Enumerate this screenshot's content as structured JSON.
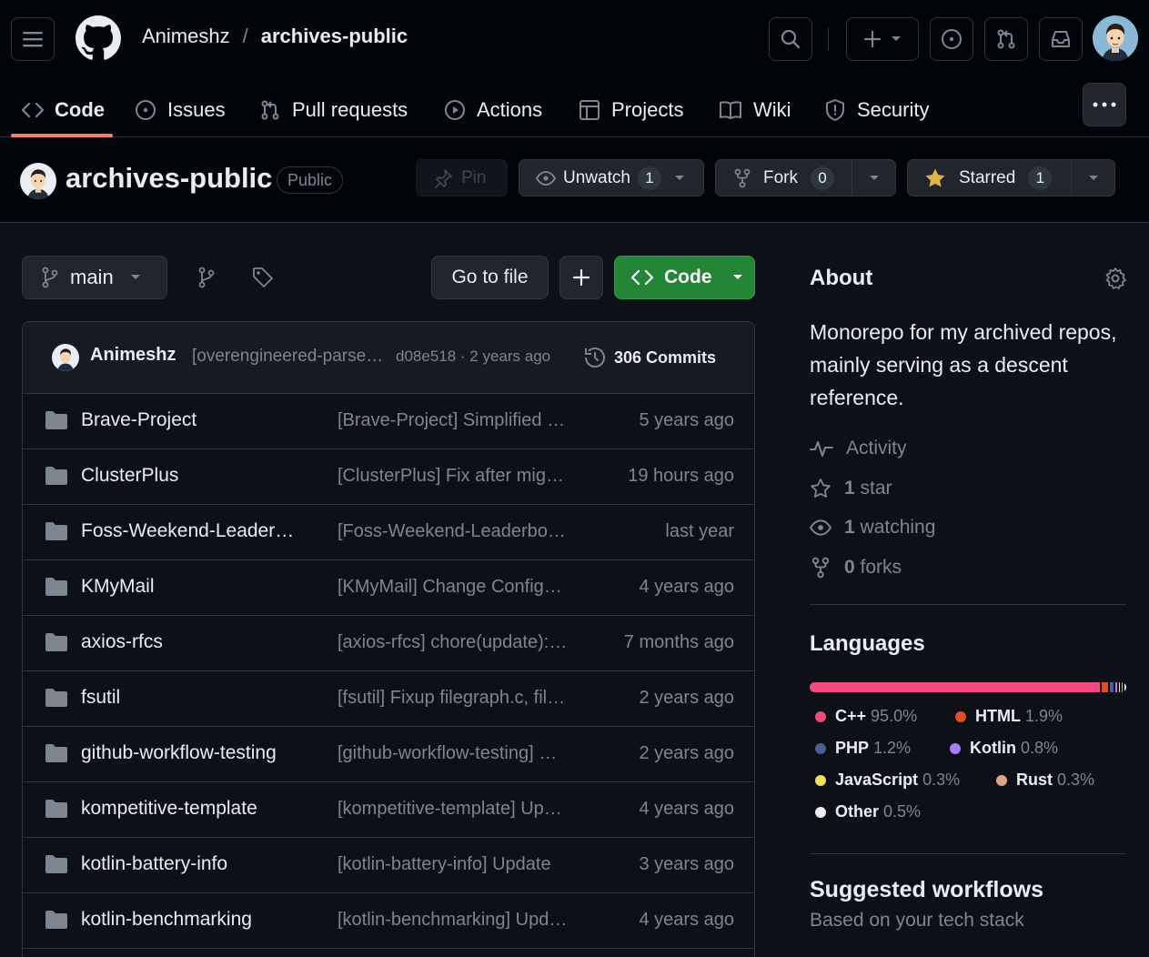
{
  "breadcrumb": {
    "owner": "Animeshz",
    "separator": "/",
    "repo": "archives-public"
  },
  "tabs": [
    {
      "label": "Code",
      "icon": "code-icon"
    },
    {
      "label": "Issues",
      "icon": "issue-icon"
    },
    {
      "label": "Pull requests",
      "icon": "pull-request-icon"
    },
    {
      "label": "Actions",
      "icon": "play-icon"
    },
    {
      "label": "Projects",
      "icon": "table-icon"
    },
    {
      "label": "Wiki",
      "icon": "book-icon"
    },
    {
      "label": "Security",
      "icon": "shield-icon"
    }
  ],
  "repo_header": {
    "name": "archives-public",
    "visibility": "Public",
    "pin_label": "Pin",
    "watch_label": "Unwatch",
    "watch_count": "1",
    "fork_label": "Fork",
    "fork_count": "0",
    "star_label": "Starred",
    "star_count": "1"
  },
  "toolbar": {
    "branch": "main",
    "goto_file": "Go to file",
    "code_button": "Code"
  },
  "latest_commit": {
    "author": "Animeshz",
    "message": "[overengineered-parser] ...",
    "meta": "d08e518 · 2 years ago",
    "commits": "306 Commits"
  },
  "files": [
    {
      "name": "Brave-Project",
      "message": "[Brave-Project] Simplified build",
      "date": "5 years ago"
    },
    {
      "name": "ClusterPlus",
      "message": "[ClusterPlus] Fix after migration",
      "date": "19 hours ago"
    },
    {
      "name": "Foss-Weekend-Leaderboard",
      "message": "[Foss-Weekend-Leaderboard] Update",
      "date": "last year"
    },
    {
      "name": "KMyMail",
      "message": "[KMyMail] Change Configuration",
      "date": "4 years ago"
    },
    {
      "name": "axios-rfcs",
      "message": "[axios-rfcs] chore(update): rfcs",
      "date": "7 months ago"
    },
    {
      "name": "fsutil",
      "message": "[fsutil] Fixup filegraph.c, filegraph.h",
      "date": "2 years ago"
    },
    {
      "name": "github-workflow-testing",
      "message": "[github-workflow-testing] Update",
      "date": "2 years ago"
    },
    {
      "name": "kompetitive-template",
      "message": "[kompetitive-template] Update",
      "date": "4 years ago"
    },
    {
      "name": "kotlin-battery-info",
      "message": "[kotlin-battery-info] Update",
      "date": "3 years ago"
    },
    {
      "name": "kotlin-benchmarking",
      "message": "[kotlin-benchmarking] Update",
      "date": "4 years ago"
    }
  ],
  "about": {
    "title": "About",
    "description": "Monorepo for my archived repos, mainly serving as a descent reference.",
    "activity": "Activity",
    "stars_count": "1",
    "stars_label": "star",
    "watching_count": "1",
    "watching_label": "watching",
    "forks_count": "0",
    "forks_label": "forks"
  },
  "languages": {
    "title": "Languages",
    "items": [
      {
        "name": "C++",
        "pct": "95.0%",
        "value": 95.0,
        "color": "#f34b7d"
      },
      {
        "name": "HTML",
        "pct": "1.9%",
        "value": 1.9,
        "color": "#e34c26"
      },
      {
        "name": "PHP",
        "pct": "1.2%",
        "value": 1.2,
        "color": "#4F5D95"
      },
      {
        "name": "Kotlin",
        "pct": "0.8%",
        "value": 0.8,
        "color": "#A97BFF"
      },
      {
        "name": "JavaScript",
        "pct": "0.3%",
        "value": 0.3,
        "color": "#f1e05a"
      },
      {
        "name": "Rust",
        "pct": "0.3%",
        "value": 0.3,
        "color": "#dea584"
      },
      {
        "name": "Other",
        "pct": "0.5%",
        "value": 0.5,
        "color": "#ededed"
      }
    ]
  },
  "suggested": {
    "title": "Suggested workflows",
    "subtitle": "Based on your tech stack"
  }
}
